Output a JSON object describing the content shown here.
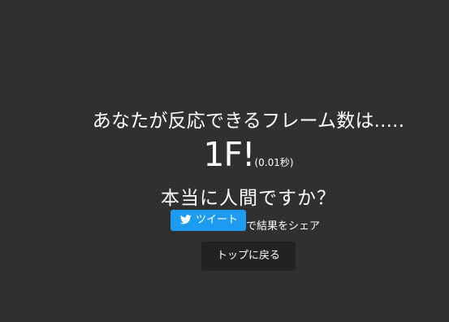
{
  "result": {
    "question": "あなたが反応できるフレーム数は.....",
    "frames": "1F!",
    "seconds": "(0.01秒)",
    "verdict": "本当に人間ですか？"
  },
  "share": {
    "tweet_label": "ツイート",
    "suffix": "で結果をシェア",
    "icon": "twitter-bird-icon",
    "color": "#1d9bf0"
  },
  "nav": {
    "back_to_top_label": "トップに戻る"
  },
  "colors": {
    "background": "#303030",
    "button_dark": "#222222",
    "text": "#ffffff"
  }
}
